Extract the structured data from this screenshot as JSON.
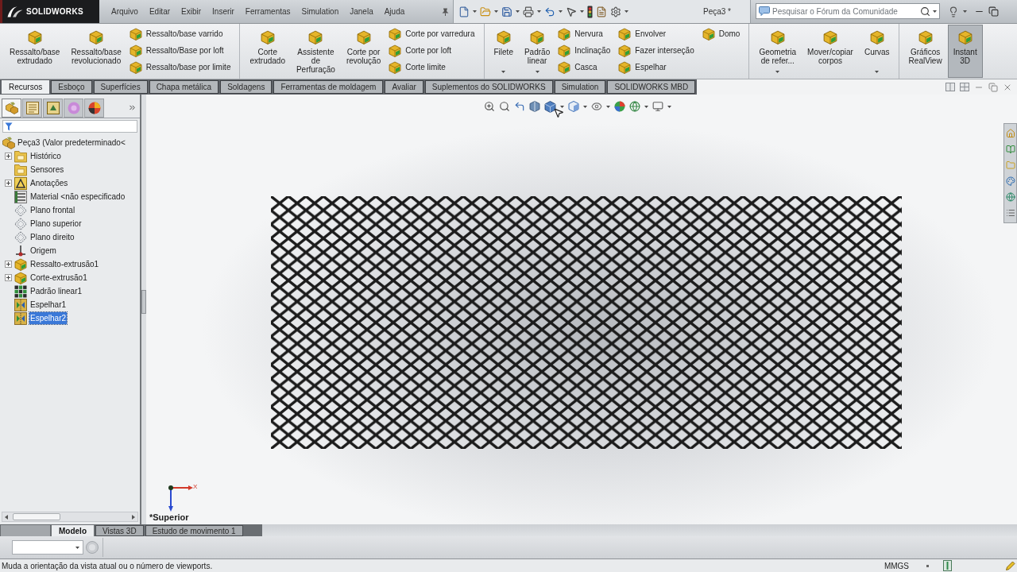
{
  "app": {
    "logo": "SOLIDWORKS",
    "document_title": "Peça3 *"
  },
  "menu": [
    "Arquivo",
    "Editar",
    "Exibir",
    "Inserir",
    "Ferramentas",
    "Simulation",
    "Janela",
    "Ajuda"
  ],
  "search": {
    "placeholder": "Pesquisar o Fórum da Comunidade"
  },
  "ribbon": {
    "groups": [
      {
        "items": [
          {
            "kind": "large",
            "label": "Ressalto/base extrudado",
            "dropdown": false,
            "pressed": false
          },
          {
            "kind": "large",
            "label": "Ressalto/base revolucionado",
            "dropdown": false,
            "pressed": false
          },
          {
            "kind": "stack",
            "items": [
              "Ressalto/base varrido",
              "Ressalto/Base por loft",
              "Ressalto/base por limite"
            ]
          }
        ]
      },
      {
        "items": [
          {
            "kind": "large",
            "label": "Corte extrudado",
            "dropdown": false,
            "pressed": false
          },
          {
            "kind": "large",
            "label": "Assistente de Perfuração",
            "dropdown": false,
            "pressed": false
          },
          {
            "kind": "large",
            "label": "Corte por revolução",
            "dropdown": false,
            "pressed": false
          },
          {
            "kind": "stack",
            "items": [
              "Corte por varredura",
              "Corte por loft",
              "Corte limite"
            ]
          }
        ]
      },
      {
        "items": [
          {
            "kind": "large",
            "label": "Filete",
            "dropdown": true,
            "pressed": false
          },
          {
            "kind": "large",
            "label": "Padrão linear",
            "dropdown": true,
            "pressed": false
          },
          {
            "kind": "stack",
            "items": [
              "Nervura",
              "Inclinação",
              "Casca"
            ]
          },
          {
            "kind": "stack",
            "items": [
              "Envolver",
              "Fazer interseção",
              "Espelhar"
            ]
          },
          {
            "kind": "stack",
            "items": [
              "Domo"
            ]
          }
        ]
      },
      {
        "items": [
          {
            "kind": "large",
            "label": "Geometria de refer...",
            "dropdown": true,
            "pressed": false
          },
          {
            "kind": "large",
            "label": "Mover/copiar corpos",
            "dropdown": false,
            "pressed": false
          },
          {
            "kind": "large",
            "label": "Curvas",
            "dropdown": true,
            "pressed": false
          }
        ]
      },
      {
        "items": [
          {
            "kind": "large",
            "label": "Gráficos RealView",
            "dropdown": false,
            "pressed": false
          },
          {
            "kind": "large",
            "label": "Instant 3D",
            "dropdown": false,
            "pressed": true
          }
        ]
      }
    ]
  },
  "command_tabs": [
    {
      "label": "Recursos",
      "selected": true
    },
    {
      "label": "Esboço",
      "selected": false
    },
    {
      "label": "Superfícies",
      "selected": false
    },
    {
      "label": "Chapa metálica",
      "selected": false
    },
    {
      "label": "Soldagens",
      "selected": false
    },
    {
      "label": "Ferramentas de moldagem",
      "selected": false
    },
    {
      "label": "Avaliar",
      "selected": false
    },
    {
      "label": "Suplementos do SOLIDWORKS",
      "selected": false
    },
    {
      "label": "Simulation",
      "selected": false
    },
    {
      "label": "SOLIDWORKS MBD",
      "selected": false
    }
  ],
  "feature_panel": {
    "tabs": [
      {
        "selected": true
      },
      {
        "selected": false
      },
      {
        "selected": false
      },
      {
        "selected": false
      },
      {
        "selected": false
      }
    ],
    "tree": {
      "label": "Peça3 (Valor predeterminado<",
      "children": [
        {
          "label": "Histórico",
          "collapsed": true,
          "selected": false
        },
        {
          "label": "Sensores",
          "collapsed": false,
          "selected": false
        },
        {
          "label": "Anotações",
          "collapsed": true,
          "selected": false
        },
        {
          "label": "Material <não especificado",
          "collapsed": false,
          "selected": false
        },
        {
          "label": "Plano frontal",
          "collapsed": false,
          "selected": false
        },
        {
          "label": "Plano superior",
          "collapsed": false,
          "selected": false
        },
        {
          "label": "Plano direito",
          "collapsed": false,
          "selected": false
        },
        {
          "label": "Origem",
          "collapsed": false,
          "selected": false
        },
        {
          "label": "Ressalto-extrusão1",
          "collapsed": true,
          "selected": false
        },
        {
          "label": "Corte-extrusão1",
          "collapsed": true,
          "selected": false
        },
        {
          "label": "Padrão linear1",
          "collapsed": false,
          "selected": false
        },
        {
          "label": "Espelhar1",
          "collapsed": false,
          "selected": false
        },
        {
          "label": "Espelhar2",
          "collapsed": false,
          "selected": true
        }
      ]
    }
  },
  "viewport": {
    "triad_x_label": "X",
    "view_name": "*Superior"
  },
  "bottom_tabs": [
    {
      "label": "Modelo",
      "selected": true
    },
    {
      "label": "Vistas 3D",
      "selected": false
    },
    {
      "label": "Estudo de movimento 1",
      "selected": false
    }
  ],
  "status_bar": {
    "message": "Muda a orientação da vista atual ou o número de viewports.",
    "units": "MMGS"
  }
}
